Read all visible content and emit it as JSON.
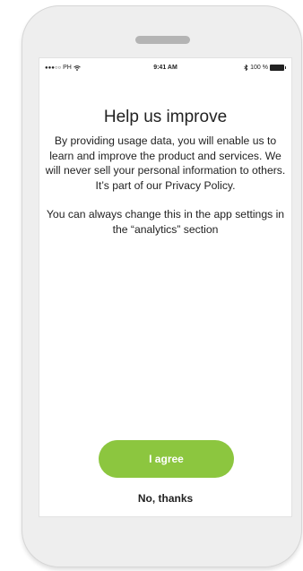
{
  "status_bar": {
    "carrier": "PH",
    "time": "9:41 AM",
    "battery": "100 %",
    "battery_level_percent": 100
  },
  "title": "Help us improve",
  "paragraphs": [
    "By providing usage data, you will enable us to learn and improve the product and services. We will never sell your personal information to others. It’s part of our Privacy Policy.",
    "You can always change this in the app settings in the “analytics” section"
  ],
  "buttons": {
    "agree_label": "I agree",
    "decline_label": "No, thanks"
  },
  "colors": {
    "accent": "#8cc63f",
    "text": "#222222",
    "device_frame": "#eeeeee"
  },
  "icons": {
    "signal": "signal-dots-icon",
    "wifi": "wifi-icon",
    "bluetooth": "bluetooth-icon",
    "battery": "battery-icon"
  }
}
